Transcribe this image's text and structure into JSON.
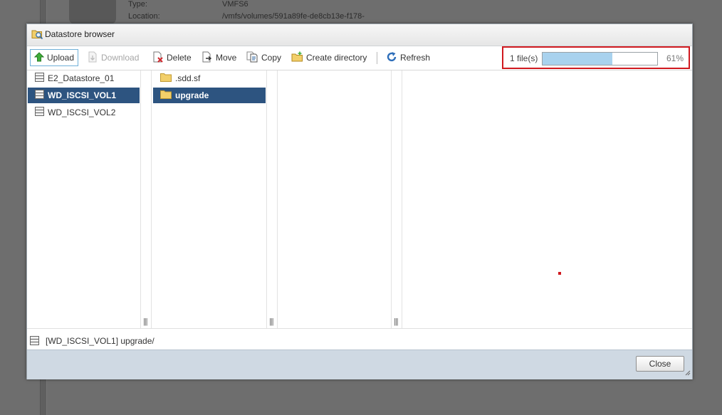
{
  "background": {
    "type_label": "Type:",
    "type_value": "VMFS6",
    "location_label": "Location:",
    "location_value": "/vmfs/volumes/591a89fe-de8cb13e-f178-"
  },
  "dialog": {
    "title": "Datastore browser",
    "toolbar": {
      "upload": "Upload",
      "download": "Download",
      "delete": "Delete",
      "move": "Move",
      "copy": "Copy",
      "create_directory": "Create directory",
      "refresh": "Refresh"
    },
    "upload_progress": {
      "files_label": "1 file(s)",
      "percent": 61,
      "percent_label": "61%"
    },
    "datastores": [
      {
        "name": "E2_Datastore_01",
        "selected": false
      },
      {
        "name": "WD_ISCSI_VOL1",
        "selected": true
      },
      {
        "name": "WD_ISCSI_VOL2",
        "selected": false
      }
    ],
    "folders": [
      {
        "name": ".sdd.sf",
        "selected": false
      },
      {
        "name": "upgrade",
        "selected": true
      }
    ],
    "current_path": "[WD_ISCSI_VOL1] upgrade/",
    "close_label": "Close"
  },
  "colors": {
    "selection": "#2d5480",
    "progress_fill": "#a9d2ee",
    "highlight_border": "#d0191f",
    "footer": "#cfd9e3"
  }
}
